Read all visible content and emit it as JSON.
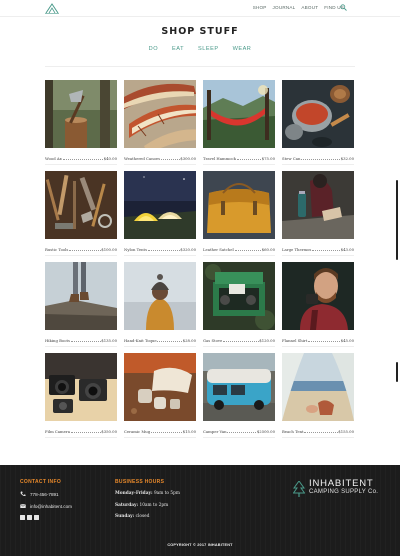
{
  "nav": {
    "links": [
      "SHOP",
      "JOURNAL",
      "ABOUT",
      "FIND US"
    ],
    "search_icon": "search-icon",
    "logo_icon": "mountain-tent-logo"
  },
  "page": {
    "title": "SHOP STUFF",
    "tabs": [
      "DO",
      "EAT",
      "SLEEP",
      "WEAR"
    ]
  },
  "products": [
    {
      "name": "Wood Ax",
      "price": "$40.00"
    },
    {
      "name": "Weathered Canoes",
      "price": "$300.00"
    },
    {
      "name": "Travel Hammock",
      "price": "$75.00"
    },
    {
      "name": "Stew Can",
      "price": "$32.00"
    },
    {
      "name": "Rustic Tools",
      "price": "$100.00"
    },
    {
      "name": "Nylon Tents",
      "price": "$320.00"
    },
    {
      "name": "Leather Satchel",
      "price": "$60.00"
    },
    {
      "name": "Large Thermos",
      "price": "$43.00"
    },
    {
      "name": "Hiking Boots",
      "price": "$135.00"
    },
    {
      "name": "Hand-Knit Toque",
      "price": "$28.00"
    },
    {
      "name": "Gas Stove",
      "price": "$120.00"
    },
    {
      "name": "Flannel Shirt",
      "price": "$45.00"
    },
    {
      "name": "Film Camera",
      "price": "$350.00"
    },
    {
      "name": "Ceramic Mug",
      "price": "$15.00"
    },
    {
      "name": "Camper Van",
      "price": "$2500.00"
    },
    {
      "name": "Beach Tent",
      "price": "$155.00"
    }
  ],
  "footer": {
    "contact_heading": "CONTACT INFO",
    "phone": "778-456-7891",
    "email": "info@inhabitent.com",
    "hours_heading": "BUSINESS HOURS",
    "hours": [
      {
        "day": "Monday-Friday:",
        "time": "9am to 5pm"
      },
      {
        "day": "Saturday:",
        "time": "10am to 2pm"
      },
      {
        "day": "Sunday:",
        "time": "closed"
      }
    ],
    "brand_name": "INHABITENT",
    "brand_sub": "CAMPING SUPPLY Co.",
    "copyright": "COPYRIGHT © 2017 INHABITENT",
    "social_icons": [
      "facebook-icon",
      "twitter-icon",
      "google-plus-icon"
    ]
  },
  "colors": {
    "accent_teal": "#4a9a8a",
    "footer_heading": "#e8892b",
    "footer_bg": "#1c1c1c"
  }
}
